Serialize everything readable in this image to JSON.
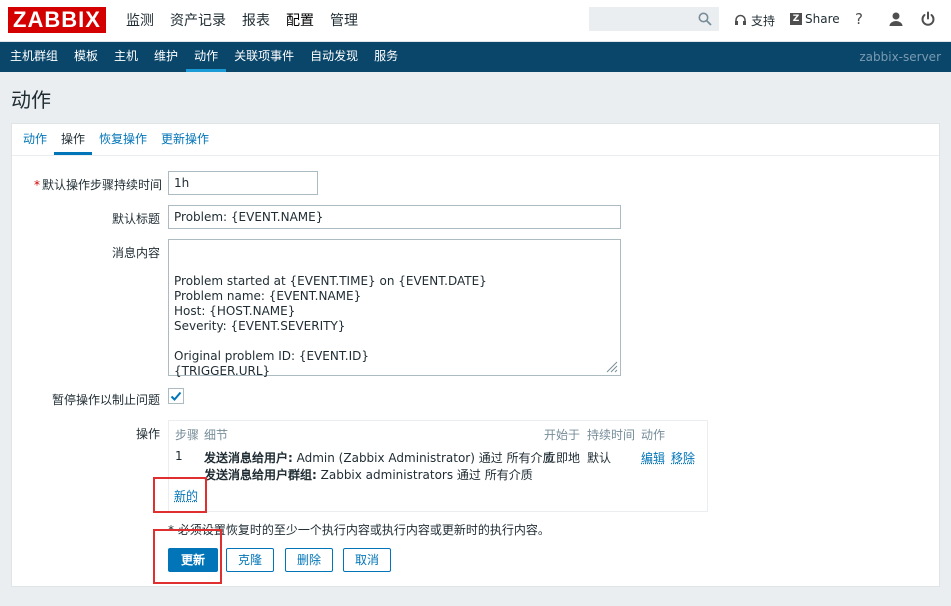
{
  "header": {
    "logo": "ZABBIX",
    "menu": [
      "监测",
      "资产记录",
      "报表",
      "配置",
      "管理"
    ],
    "selected_menu": "配置",
    "support_label": "支持",
    "share_label": "Share",
    "share_badge": "Z",
    "help_label": "?"
  },
  "submenu": {
    "items": [
      "主机群组",
      "模板",
      "主机",
      "维护",
      "动作",
      "关联项事件",
      "自动发现",
      "服务"
    ],
    "selected": "动作",
    "server_name": "zabbix-server"
  },
  "page": {
    "title": "动作"
  },
  "tabs": [
    "动作",
    "操作",
    "恢复操作",
    "更新操作"
  ],
  "active_tab": "操作",
  "form": {
    "duration_label": "默认操作步骤持续时间",
    "duration_value": "1h",
    "subject_label": "默认标题",
    "subject_value": "Problem: {EVENT.NAME}",
    "message_label": "消息内容",
    "message_value": "Problem started at {EVENT.TIME} on {EVENT.DATE}\nProblem name: {EVENT.NAME}\nHost: {HOST.NAME}\nSeverity: {EVENT.SEVERITY}\n\nOriginal problem ID: {EVENT.ID}\n{TRIGGER.URL}",
    "pause_label": "暂停操作以制止问题",
    "pause_checked": true,
    "operations_label": "操作"
  },
  "operations": {
    "headers": {
      "step": "步骤",
      "details": "细节",
      "start_in": "开始于",
      "duration": "持续时间",
      "action": "动作"
    },
    "rows": [
      {
        "step": "1",
        "detail_line1_bold": "发送消息给用户:",
        "detail_line1_text": " Admin (Zabbix Administrator) 通过 所有介质",
        "detail_line2_bold": "发送消息给用户群组:",
        "detail_line2_text": " Zabbix administrators 通过 所有介质",
        "start_in": "立即地",
        "duration": "默认",
        "edit": "编辑",
        "remove": "移除"
      }
    ],
    "new_link": "新的"
  },
  "note": "* 必须设置恢复时的至少一个执行内容或执行内容或更新时的执行内容。",
  "buttons": {
    "update": "更新",
    "clone": "克隆",
    "delete": "删除",
    "cancel": "取消"
  },
  "colors": {
    "brand": "#d40000",
    "nav_bg": "#0a466a",
    "link": "#0275b8",
    "highlight_box": "#e02f2f"
  }
}
